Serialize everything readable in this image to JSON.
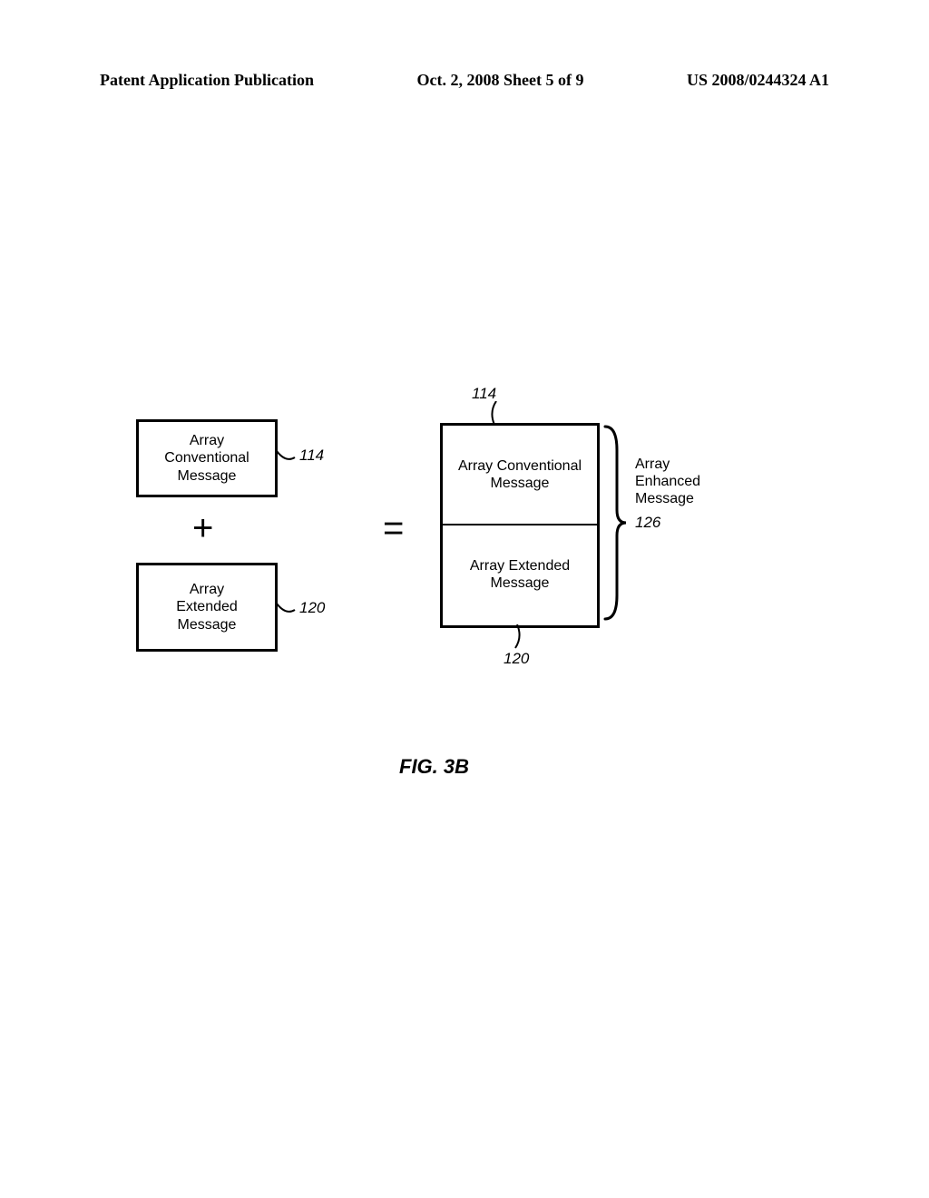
{
  "header": {
    "left": "Patent Application Publication",
    "center": "Oct. 2, 2008  Sheet 5 of 9",
    "right": "US 2008/0244324 A1"
  },
  "diagram": {
    "leftTop": {
      "text": "Array\nConventional\nMessage",
      "ref": "114"
    },
    "leftBottom": {
      "text": "Array\nExtended\nMessage",
      "ref": "120"
    },
    "plus": "+",
    "equals": "=",
    "stackTop": {
      "text": "Array\nConventional\nMessage",
      "ref": "114"
    },
    "stackBottom": {
      "text": "Array\nExtended\nMessage",
      "ref": "120"
    },
    "rightLabel": {
      "text": "Array\nEnhanced\nMessage",
      "ref": "126"
    }
  },
  "figure": "FIG. 3B"
}
